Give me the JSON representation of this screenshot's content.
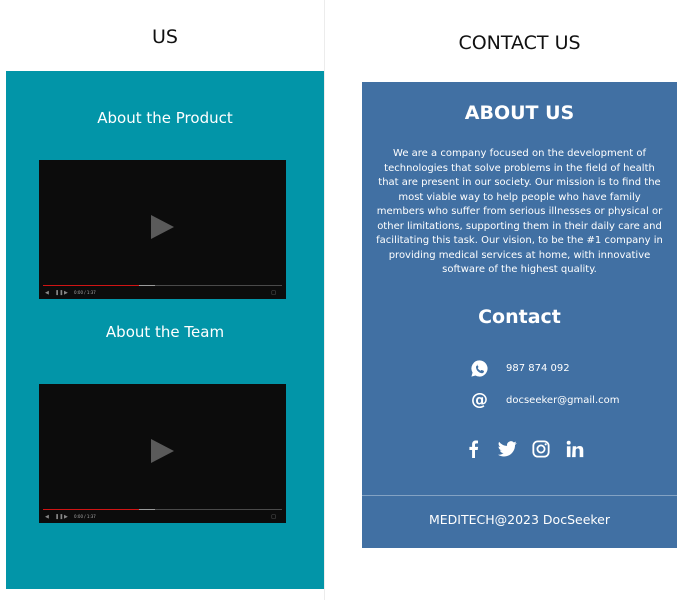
{
  "left": {
    "title": "US",
    "sections": [
      {
        "heading": "About the Product",
        "video": {
          "time": "0:00 / 1:37",
          "played_fraction": 0.4,
          "buffered_fraction": 0.47
        }
      },
      {
        "heading": "About the Team",
        "video": {
          "time": "0:00 / 1:37",
          "played_fraction": 0.4,
          "buffered_fraction": 0.47
        }
      }
    ]
  },
  "right": {
    "title": "CONTACT US",
    "about": {
      "heading": "ABOUT US",
      "body": "We are a company focused on the development of technologies that solve problems in the field of health that are present in our society. Our mission is to find the most viable way to help people who have family members who suffer from serious illnesses or physical or other limitations, supporting them in their daily care and facilitating this task. Our vision, to be the #1 company in providing medical services at home, with innovative software of the highest quality."
    },
    "contact": {
      "heading": "Contact",
      "phone": {
        "icon": "whatsapp-icon",
        "value": "987 874 092"
      },
      "email": {
        "icon": "at-sign-icon",
        "value": "docseeker@gmail.com"
      }
    },
    "social": [
      "facebook-icon",
      "twitter-icon",
      "instagram-icon",
      "linkedin-icon"
    ],
    "footer": "MEDITECH@2023  DocSeeker"
  },
  "colors": {
    "left_panel": "#0295a8",
    "right_panel": "#4170a3",
    "progress": "#d01414"
  }
}
